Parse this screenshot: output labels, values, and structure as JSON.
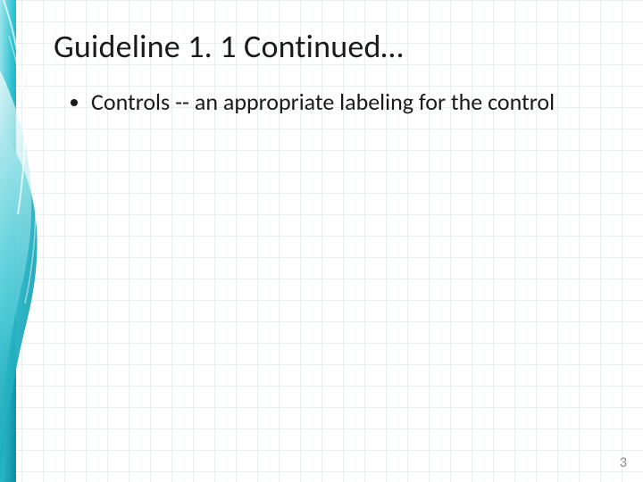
{
  "slide": {
    "title": "Guideline 1. 1 Continued…",
    "bullets": [
      "Controls -- an appropriate labeling for the control"
    ],
    "page_number": "3"
  },
  "theme": {
    "accent": "#1fb6c4",
    "accent_dark": "#0e8aa0",
    "grid_line": "#e9eeee"
  }
}
